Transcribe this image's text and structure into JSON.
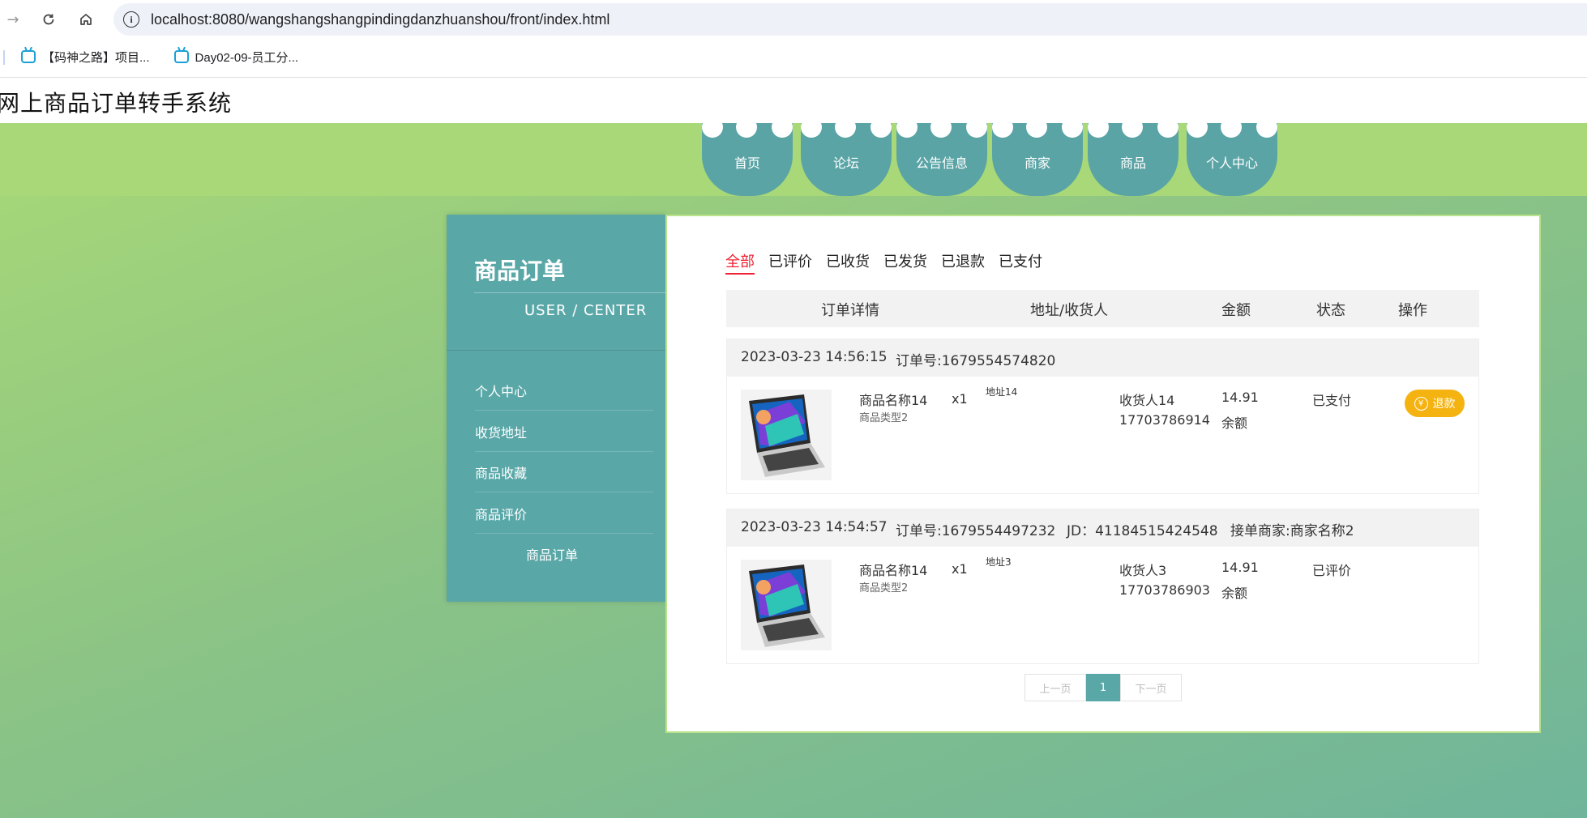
{
  "browser": {
    "url": "localhost:8080/wangshangshangpindingdanzhuanshou/front/index.html",
    "bookmarks": [
      "【码神之路】项目...",
      "Day02-09-员工分..."
    ]
  },
  "site": {
    "title": "网上商品订单转手系统"
  },
  "nav": [
    "首页",
    "论坛",
    "公告信息",
    "商家",
    "商品",
    "个人中心"
  ],
  "sidebar": {
    "title": "商品订单",
    "subtitle": "USER / CENTER",
    "items": [
      "个人中心",
      "收货地址",
      "商品收藏",
      "商品评价",
      "商品订单"
    ]
  },
  "tabs": [
    "全部",
    "已评价",
    "已收货",
    "已发货",
    "已退款",
    "已支付"
  ],
  "table_headers": [
    "订单详情",
    "地址/收货人",
    "金额",
    "状态",
    "操作"
  ],
  "orders": [
    {
      "datetime": "2023-03-23 14:56:15",
      "order_no": "订单号:1679554574820",
      "product_name": "商品名称14",
      "product_type": "商品类型2",
      "qty": "x1",
      "address": "地址14",
      "receiver": "收货人14",
      "phone": "17703786914",
      "amount": "14.91",
      "pay_method": "余额",
      "status": "已支付",
      "action": "退款"
    },
    {
      "datetime": "2023-03-23 14:54:57",
      "order_no": "订单号:1679554497232",
      "jd": "JD：41184515424548",
      "merchant": "接单商家:商家名称2",
      "product_name": "商品名称14",
      "product_type": "商品类型2",
      "qty": "x1",
      "address": "地址3",
      "receiver": "收货人3",
      "phone": "17703786903",
      "amount": "14.91",
      "pay_method": "余额",
      "status": "已评价"
    }
  ],
  "pagination": {
    "prev": "上一页",
    "current": "1",
    "next": "下一页"
  },
  "colors": {
    "teal": "#5aa7a8",
    "green": "#a8d877",
    "refund": "#f5b311",
    "active_tab": "#e22233"
  }
}
